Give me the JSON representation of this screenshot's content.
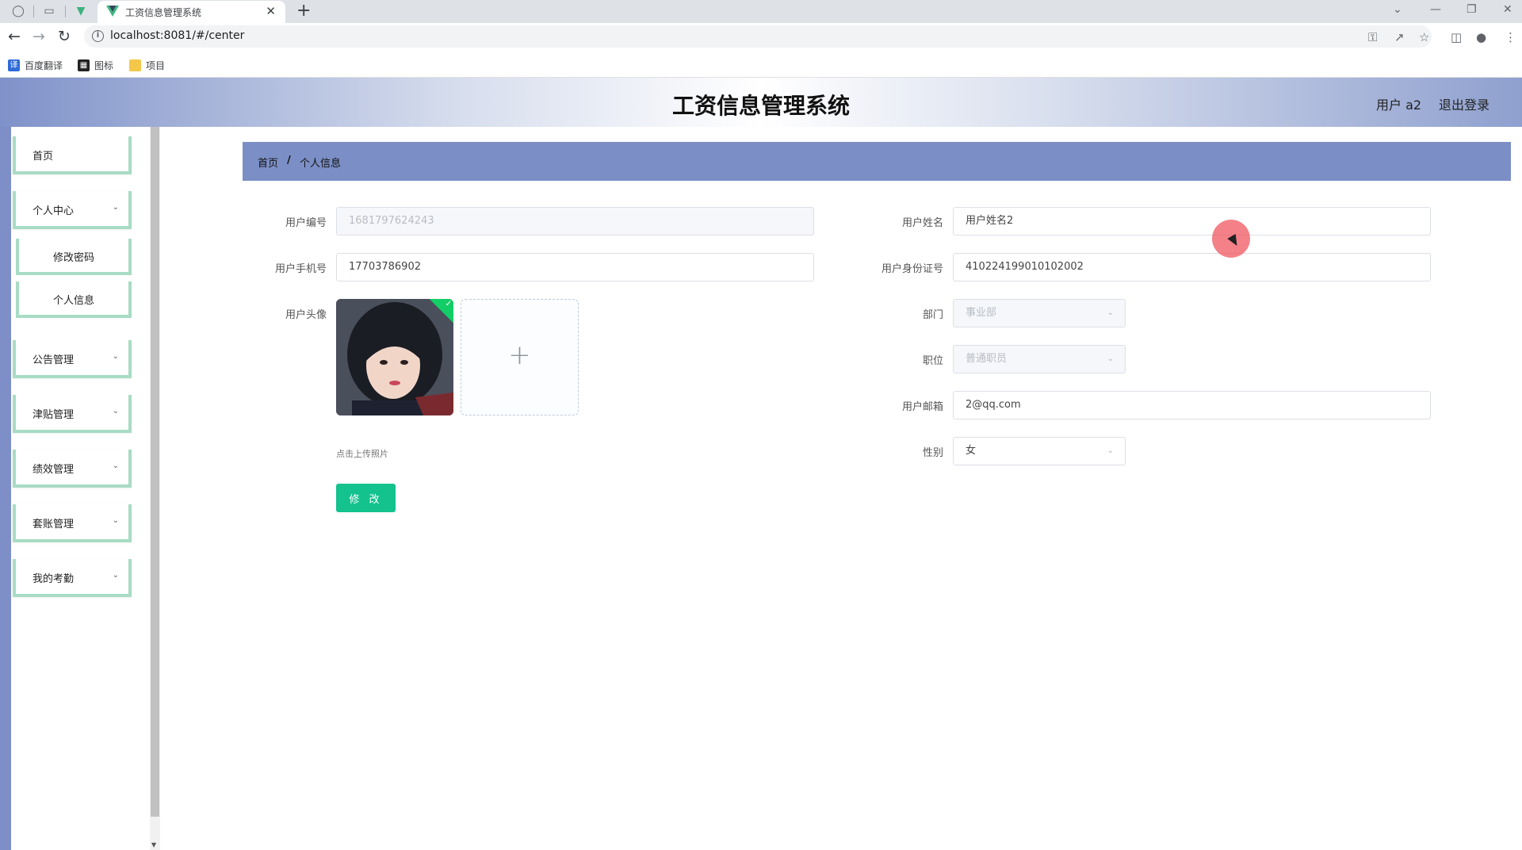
{
  "browser": {
    "tab_title": "工资信息管理系统",
    "url": "localhost:8081/#/center",
    "bookmarks": [
      {
        "label": "百度翻译"
      },
      {
        "label": "图标"
      },
      {
        "label": "项目"
      }
    ]
  },
  "header": {
    "title": "工资信息管理系统",
    "user_label": "用户 a2",
    "logout_label": "退出登录"
  },
  "sidebar": {
    "items": [
      {
        "label": "首页"
      },
      {
        "label": "个人中心"
      },
      {
        "label": "修改密码"
      },
      {
        "label": "个人信息"
      },
      {
        "label": "公告管理"
      },
      {
        "label": "津贴管理"
      },
      {
        "label": "绩效管理"
      },
      {
        "label": "套账管理"
      },
      {
        "label": "我的考勤"
      }
    ]
  },
  "breadcrumb": {
    "home": "首页",
    "separator": "/",
    "current": "个人信息"
  },
  "form": {
    "user_no_label": "用户编号",
    "user_no_value": "1681797624243",
    "user_name_label": "用户姓名",
    "user_name_value": "用户姓名2",
    "phone_label": "用户手机号",
    "phone_value": "17703786902",
    "id_card_label": "用户身份证号",
    "id_card_value": "410224199010102002",
    "avatar_label": "用户头像",
    "dept_label": "部门",
    "dept_value": "事业部",
    "position_label": "职位",
    "position_value": "普通职员",
    "email_label": "用户邮箱",
    "email_value": "2@qq.com",
    "gender_label": "性别",
    "gender_value": "女",
    "upload_tip": "点击上传照片",
    "submit_label": "修 改"
  },
  "colors": {
    "accent_green": "#13c28d",
    "breadcrumb_blue": "#7b8fc6",
    "menu_border": "#a8dcc4"
  }
}
